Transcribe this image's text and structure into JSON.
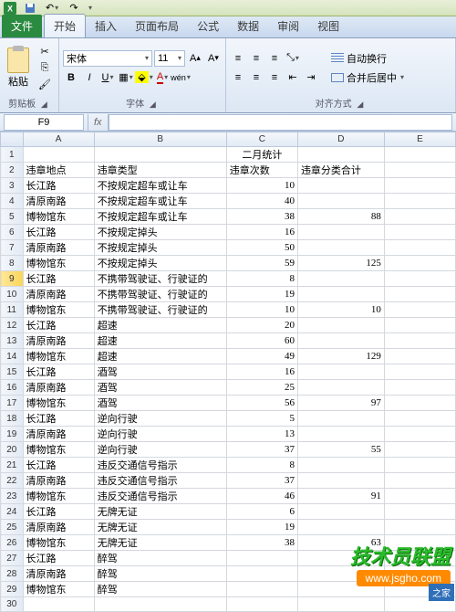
{
  "qat": {
    "save": "保存",
    "undo": "撤销",
    "redo": "恢复"
  },
  "tabs": {
    "file": "文件",
    "items": [
      "开始",
      "插入",
      "页面布局",
      "公式",
      "数据",
      "审阅",
      "视图"
    ],
    "active_index": 0
  },
  "ribbon": {
    "clipboard": {
      "label": "剪贴板",
      "paste": "粘贴"
    },
    "font": {
      "label": "字体",
      "name": "宋体",
      "size": "11",
      "bold": "B",
      "italic": "I",
      "underline": "U"
    },
    "alignment": {
      "label": "对齐方式",
      "wrap": "自动换行",
      "merge": "合并后居中"
    }
  },
  "namebox": "F9",
  "formula": "",
  "columns": [
    "A",
    "B",
    "C",
    "D",
    "E"
  ],
  "title": "二月统计",
  "headers": {
    "A": "违章地点",
    "B": "违章类型",
    "C": "违章次数",
    "D": "违章分类合计"
  },
  "rows": [
    {
      "A": "长江路",
      "B": "不按规定超车或让车",
      "C": "10",
      "D": ""
    },
    {
      "A": "清原南路",
      "B": "不按规定超车或让车",
      "C": "40",
      "D": ""
    },
    {
      "A": "博物馆东",
      "B": "不按规定超车或让车",
      "C": "38",
      "D": "88"
    },
    {
      "A": "长江路",
      "B": "不按规定掉头",
      "C": "16",
      "D": ""
    },
    {
      "A": "清原南路",
      "B": "不按规定掉头",
      "C": "50",
      "D": ""
    },
    {
      "A": "博物馆东",
      "B": "不按规定掉头",
      "C": "59",
      "D": "125"
    },
    {
      "A": "长江路",
      "B": "不携带驾驶证、行驶证的",
      "C": "8",
      "D": ""
    },
    {
      "A": "清原南路",
      "B": "不携带驾驶证、行驶证的",
      "C": "19",
      "D": ""
    },
    {
      "A": "博物馆东",
      "B": "不携带驾驶证、行驶证的",
      "C": "10",
      "D": "10"
    },
    {
      "A": "长江路",
      "B": "超速",
      "C": "20",
      "D": ""
    },
    {
      "A": "清原南路",
      "B": "超速",
      "C": "60",
      "D": ""
    },
    {
      "A": "博物馆东",
      "B": "超速",
      "C": "49",
      "D": "129"
    },
    {
      "A": "长江路",
      "B": "酒驾",
      "C": "16",
      "D": ""
    },
    {
      "A": "清原南路",
      "B": "酒驾",
      "C": "25",
      "D": ""
    },
    {
      "A": "博物馆东",
      "B": "酒驾",
      "C": "56",
      "D": "97"
    },
    {
      "A": "长江路",
      "B": "逆向行驶",
      "C": "5",
      "D": ""
    },
    {
      "A": "清原南路",
      "B": "逆向行驶",
      "C": "13",
      "D": ""
    },
    {
      "A": "博物馆东",
      "B": "逆向行驶",
      "C": "37",
      "D": "55"
    },
    {
      "A": "长江路",
      "B": "违反交通信号指示",
      "C": "8",
      "D": ""
    },
    {
      "A": "清原南路",
      "B": "违反交通信号指示",
      "C": "37",
      "D": ""
    },
    {
      "A": "博物馆东",
      "B": "违反交通信号指示",
      "C": "46",
      "D": "91"
    },
    {
      "A": "长江路",
      "B": "无牌无证",
      "C": "6",
      "D": ""
    },
    {
      "A": "清原南路",
      "B": "无牌无证",
      "C": "19",
      "D": ""
    },
    {
      "A": "博物馆东",
      "B": "无牌无证",
      "C": "38",
      "D": "63"
    },
    {
      "A": "长江路",
      "B": "醉驾",
      "C": "",
      "D": ""
    },
    {
      "A": "清原南路",
      "B": "醉驾",
      "C": "",
      "D": ""
    },
    {
      "A": "博物馆东",
      "B": "醉驾",
      "C": "",
      "D": ""
    }
  ],
  "selected_row_grid": 9,
  "watermark": {
    "big": "技术员联盟",
    "url": "www.jsgho.com",
    "side": "之家"
  }
}
